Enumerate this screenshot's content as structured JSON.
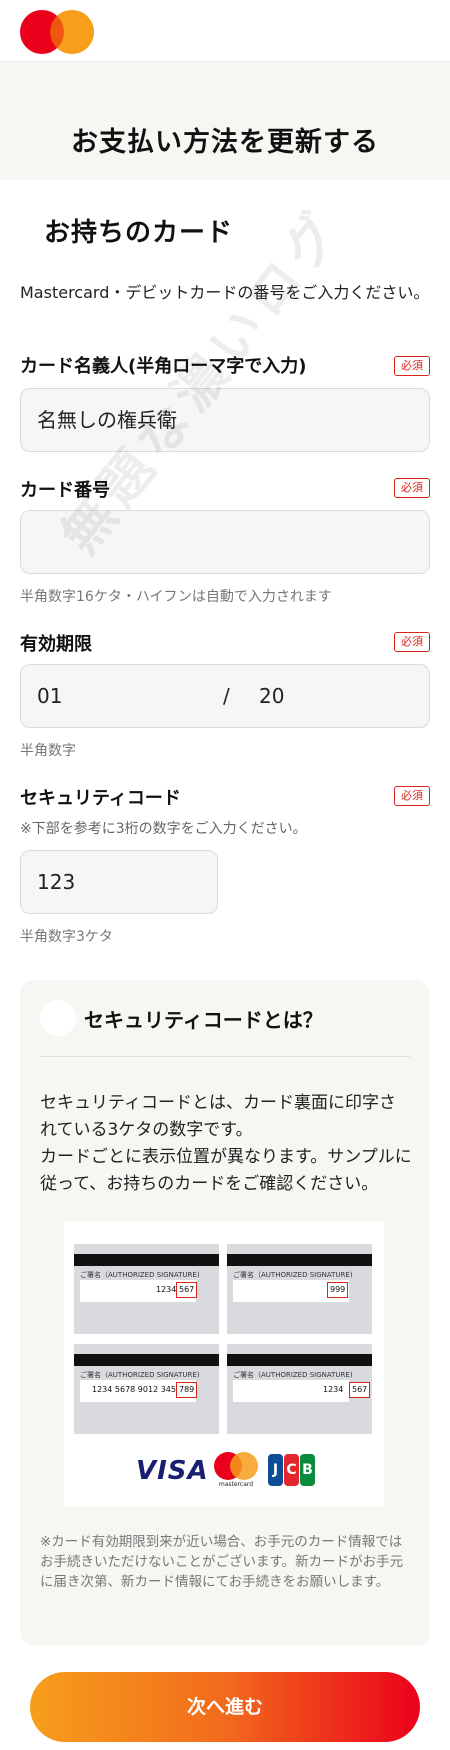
{
  "header": {
    "logo_colors": [
      "#eb001b",
      "#f79e1b"
    ]
  },
  "page_title": "お支払い方法を更新する",
  "section_title": "お持ちのカード",
  "intro_text": "Mastercard・デビットカードの番号をご入力ください。",
  "required_badge": "必須",
  "cardholder": {
    "label": "カード名義人(半角ローマ字で入力)",
    "value": "名無しの権兵衛"
  },
  "card_number": {
    "label": "カード番号",
    "value": "",
    "hint": "半角数字16ケタ・ハイフンは自動で入力されます"
  },
  "expiry": {
    "label": "有効期限",
    "month": "01",
    "separator": "/",
    "year": "20",
    "hint": "半角数字"
  },
  "security_code": {
    "label": "セキュリティコード",
    "note": "※下部を参考に3桁の数字をご入力ください。",
    "value": "123",
    "hint": "半角数字3ケタ"
  },
  "info_box": {
    "title": "セキュリティコードとは？",
    "text": "セキュリティコードとは、カード裏面に印字されている3ケタの数字です。\nカードごとに表示位置が異なります。サンプルに従って、お持ちのカードをご確認ください。",
    "sample_cards": [
      {
        "sig_label": "ご署名（AUTHORIZED SIGNATURE)",
        "number": "1234",
        "cvv": "567"
      },
      {
        "sig_label": "ご署名（AUTHORIZED SIGNATURE)",
        "number": "",
        "cvv": "999"
      },
      {
        "sig_label": "ご署名（AUTHORIZED SIGNATURE)",
        "number": "1234 5678 9012 3456",
        "cvv": "789"
      },
      {
        "sig_label": "ご署名（AUTHORIZED SIGNATURE)",
        "number": "1234",
        "cvv": "567"
      }
    ],
    "brands": {
      "visa": "VISA",
      "mastercard": "mastercard",
      "jcb": [
        "J",
        "C",
        "B"
      ]
    },
    "note": "※カード有効期限到来が近い場合、お手元のカード情報ではお手続きいただけないことがございます。新カードがお手元に届き次第、新カード情報にてお手続きをお願いします。"
  },
  "next_button": "次へ進む",
  "watermark": "無題な濃いログ"
}
